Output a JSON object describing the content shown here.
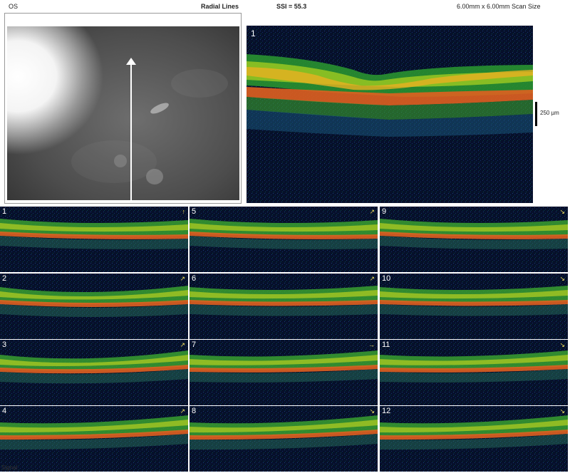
{
  "header": {
    "eye": "OS",
    "scan_pattern": "Radial Lines",
    "ssi": "SSI = 55.3",
    "scan_size": "6.00mm x 6.00mm Scan Size"
  },
  "main_scan": {
    "number": "1",
    "scale_label": "250 µm"
  },
  "thumbnails": [
    {
      "number": "1",
      "indicator": "↑"
    },
    {
      "number": "2",
      "indicator": "↗"
    },
    {
      "number": "3",
      "indicator": "↗"
    },
    {
      "number": "4",
      "indicator": "↗"
    },
    {
      "number": "5",
      "indicator": "↗"
    },
    {
      "number": "6",
      "indicator": "↗"
    },
    {
      "number": "7",
      "indicator": "→"
    },
    {
      "number": "8",
      "indicator": "↘"
    },
    {
      "number": "9",
      "indicator": "↘"
    },
    {
      "number": "10",
      "indicator": "↘"
    },
    {
      "number": "11",
      "indicator": "↘"
    },
    {
      "number": "12",
      "indicator": "↘"
    }
  ],
  "footer": "Signal"
}
